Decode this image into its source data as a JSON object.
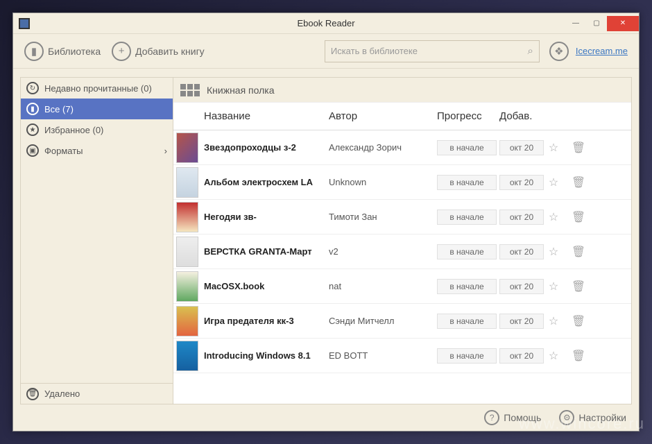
{
  "window": {
    "title": "Ebook Reader"
  },
  "toolbar": {
    "library": "Библиотека",
    "add_book": "Добавить книгу",
    "search_placeholder": "Искать в библиотеке",
    "brand_link": "Icecream.me"
  },
  "sidebar": {
    "items": [
      {
        "label": "Недавно прочитанные (0)",
        "icon": "recent"
      },
      {
        "label": "Все (7)",
        "icon": "all",
        "active": true
      },
      {
        "label": "Избранное (0)",
        "icon": "star"
      },
      {
        "label": "Форматы",
        "icon": "format",
        "chevron": true
      }
    ],
    "deleted": "Удалено"
  },
  "main": {
    "title": "Книжная полка",
    "columns": {
      "title": "Название",
      "author": "Автор",
      "progress": "Прогресс",
      "added": "Добав."
    },
    "rows": [
      {
        "title": "Звездопроходцы з-2",
        "author": "Александр Зорич",
        "progress": "в начале",
        "added": "окт 20",
        "cover": "c1"
      },
      {
        "title": "Альбом электросхем LA",
        "author": "Unknown",
        "progress": "в начале",
        "added": "окт 20",
        "cover": "c2"
      },
      {
        "title": "Негодяи зв-",
        "author": "Тимоти Зан",
        "progress": "в начале",
        "added": "окт 20",
        "cover": "c3"
      },
      {
        "title": "ВЕРСТКА GRANTA-Март",
        "author": "v2",
        "progress": "в начале",
        "added": "окт 20",
        "cover": "c4"
      },
      {
        "title": "MacOSX.book",
        "author": "nat",
        "progress": "в начале",
        "added": "окт 20",
        "cover": "c5"
      },
      {
        "title": "Игра предателя кк-3",
        "author": "Сэнди Митчелл",
        "progress": "в начале",
        "added": "окт 20",
        "cover": "c6"
      },
      {
        "title": "Introducing Windows 8.1",
        "author": "ED BOTT",
        "progress": "в начале",
        "added": "окт 20",
        "cover": "c7"
      }
    ]
  },
  "footer": {
    "help": "Помощь",
    "settings": "Настройки"
  },
  "watermark": "www.wincore.ru"
}
